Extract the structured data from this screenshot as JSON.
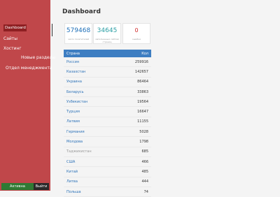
{
  "sidebar": {
    "items": [
      {
        "label": "Dashboard"
      },
      {
        "label": "Сайты"
      },
      {
        "label": "Хостинг"
      },
      {
        "label": "Новые разделы"
      },
      {
        "label": "Отдел менеджмента"
      }
    ],
    "buttons": [
      {
        "label": "Активна"
      },
      {
        "label": "Выйти"
      }
    ]
  },
  "main": {
    "title": "Dashboard",
    "stats": [
      {
        "value": "579468",
        "label": "число посетителей"
      },
      {
        "value": "34645",
        "label": "заполненных сайтов/страниц"
      },
      {
        "value": "0",
        "label": "ошибки"
      }
    ],
    "table": {
      "headers": [
        "Страна",
        "Кол"
      ],
      "rows": [
        {
          "name": "Россия",
          "value": "259916"
        },
        {
          "name": "Казахстан",
          "value": "142657"
        },
        {
          "name": "Украина",
          "value": "86464"
        },
        {
          "name": "Беларусь",
          "value": "33863"
        },
        {
          "name": "Узбекистан",
          "value": "19564"
        },
        {
          "name": "Турция",
          "value": "16647"
        },
        {
          "name": "Латвия",
          "value": "11155"
        },
        {
          "name": "Германия",
          "value": "5028"
        },
        {
          "name": "Молдова",
          "value": "1798"
        },
        {
          "name": "Таджикистан",
          "value": "685"
        },
        {
          "name": "США",
          "value": "466"
        },
        {
          "name": "Китай",
          "value": "485"
        },
        {
          "name": "Литва",
          "value": "444"
        },
        {
          "name": "Польша",
          "value": "74"
        }
      ]
    }
  }
}
